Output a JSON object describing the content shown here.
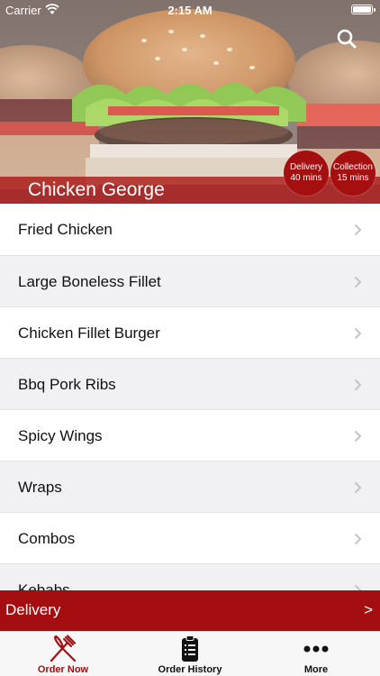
{
  "status_bar": {
    "carrier": "Carrier",
    "time": "2:15 AM"
  },
  "header": {
    "restaurant_name": "Chicken George",
    "delivery_badge": {
      "label": "Delivery",
      "time": "40 mins"
    },
    "collection_badge": {
      "label": "Collection",
      "time": "15 mins"
    },
    "search_icon": "search-icon"
  },
  "menu": {
    "items": [
      {
        "label": "Fried Chicken"
      },
      {
        "label": "Large Boneless Fillet"
      },
      {
        "label": "Chicken Fillet Burger"
      },
      {
        "label": "Bbq Pork Ribs"
      },
      {
        "label": "Spicy Wings"
      },
      {
        "label": "Wraps"
      },
      {
        "label": "Combos"
      },
      {
        "label": "Kebabs"
      }
    ]
  },
  "delivery_bar": {
    "label": "Delivery",
    "arrow": ">"
  },
  "tabs": [
    {
      "label": "Order Now",
      "icon": "fork-knife-icon",
      "active": true
    },
    {
      "label": "Order History",
      "icon": "clipboard-icon",
      "active": false
    },
    {
      "label": "More",
      "icon": "more-dots-icon",
      "active": false
    }
  ],
  "colors": {
    "accent": "#a50e10",
    "tab_active": "#a50e10",
    "tab_inactive": "#111111"
  }
}
